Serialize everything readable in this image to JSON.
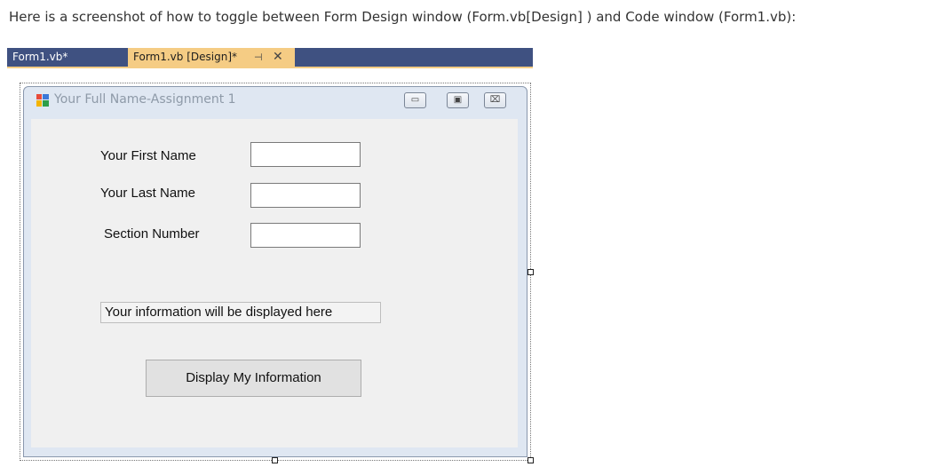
{
  "intro": "Here is a screenshot of how to toggle between Form Design window (Form.vb[Design] ) and Code window (Form1.vb):",
  "tabs": [
    {
      "label": "Form1.vb*",
      "active": false
    },
    {
      "label": "Form1.vb [Design]*",
      "active": true,
      "pin": "⊣",
      "close": "✕"
    }
  ],
  "form": {
    "title": "Your Full Name-Assignment 1",
    "controls": {
      "minimize": "▭",
      "maximize": "▣",
      "close": "⌧"
    },
    "labels": {
      "first_name": "Your First Name",
      "last_name": "Your Last Name",
      "section": "Section Number"
    },
    "textboxes": {
      "first_name": "",
      "last_name": "",
      "section": ""
    },
    "info_label": "Your information will be displayed here",
    "button": "Display My Information"
  },
  "colors": {
    "tab_bar": "#3f5181",
    "active_tab": "#f5cc84",
    "form_border": "#dfe7f2",
    "client": "#f0f0f0"
  }
}
